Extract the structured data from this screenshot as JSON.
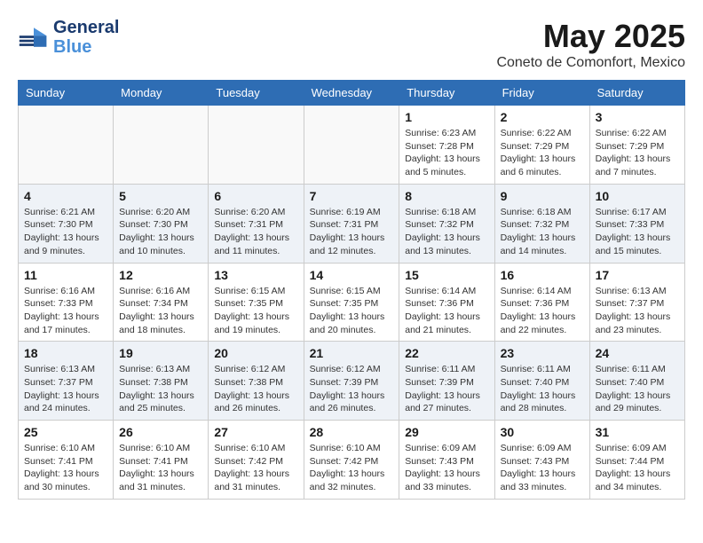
{
  "header": {
    "logo_line1": "General",
    "logo_line2": "Blue",
    "month": "May 2025",
    "location": "Coneto de Comonfort, Mexico"
  },
  "weekdays": [
    "Sunday",
    "Monday",
    "Tuesday",
    "Wednesday",
    "Thursday",
    "Friday",
    "Saturday"
  ],
  "weeks": [
    [
      {
        "day": "",
        "info": ""
      },
      {
        "day": "",
        "info": ""
      },
      {
        "day": "",
        "info": ""
      },
      {
        "day": "",
        "info": ""
      },
      {
        "day": "1",
        "info": "Sunrise: 6:23 AM\nSunset: 7:28 PM\nDaylight: 13 hours and 5 minutes."
      },
      {
        "day": "2",
        "info": "Sunrise: 6:22 AM\nSunset: 7:29 PM\nDaylight: 13 hours and 6 minutes."
      },
      {
        "day": "3",
        "info": "Sunrise: 6:22 AM\nSunset: 7:29 PM\nDaylight: 13 hours and 7 minutes."
      }
    ],
    [
      {
        "day": "4",
        "info": "Sunrise: 6:21 AM\nSunset: 7:30 PM\nDaylight: 13 hours and 9 minutes."
      },
      {
        "day": "5",
        "info": "Sunrise: 6:20 AM\nSunset: 7:30 PM\nDaylight: 13 hours and 10 minutes."
      },
      {
        "day": "6",
        "info": "Sunrise: 6:20 AM\nSunset: 7:31 PM\nDaylight: 13 hours and 11 minutes."
      },
      {
        "day": "7",
        "info": "Sunrise: 6:19 AM\nSunset: 7:31 PM\nDaylight: 13 hours and 12 minutes."
      },
      {
        "day": "8",
        "info": "Sunrise: 6:18 AM\nSunset: 7:32 PM\nDaylight: 13 hours and 13 minutes."
      },
      {
        "day": "9",
        "info": "Sunrise: 6:18 AM\nSunset: 7:32 PM\nDaylight: 13 hours and 14 minutes."
      },
      {
        "day": "10",
        "info": "Sunrise: 6:17 AM\nSunset: 7:33 PM\nDaylight: 13 hours and 15 minutes."
      }
    ],
    [
      {
        "day": "11",
        "info": "Sunrise: 6:16 AM\nSunset: 7:33 PM\nDaylight: 13 hours and 17 minutes."
      },
      {
        "day": "12",
        "info": "Sunrise: 6:16 AM\nSunset: 7:34 PM\nDaylight: 13 hours and 18 minutes."
      },
      {
        "day": "13",
        "info": "Sunrise: 6:15 AM\nSunset: 7:35 PM\nDaylight: 13 hours and 19 minutes."
      },
      {
        "day": "14",
        "info": "Sunrise: 6:15 AM\nSunset: 7:35 PM\nDaylight: 13 hours and 20 minutes."
      },
      {
        "day": "15",
        "info": "Sunrise: 6:14 AM\nSunset: 7:36 PM\nDaylight: 13 hours and 21 minutes."
      },
      {
        "day": "16",
        "info": "Sunrise: 6:14 AM\nSunset: 7:36 PM\nDaylight: 13 hours and 22 minutes."
      },
      {
        "day": "17",
        "info": "Sunrise: 6:13 AM\nSunset: 7:37 PM\nDaylight: 13 hours and 23 minutes."
      }
    ],
    [
      {
        "day": "18",
        "info": "Sunrise: 6:13 AM\nSunset: 7:37 PM\nDaylight: 13 hours and 24 minutes."
      },
      {
        "day": "19",
        "info": "Sunrise: 6:13 AM\nSunset: 7:38 PM\nDaylight: 13 hours and 25 minutes."
      },
      {
        "day": "20",
        "info": "Sunrise: 6:12 AM\nSunset: 7:38 PM\nDaylight: 13 hours and 26 minutes."
      },
      {
        "day": "21",
        "info": "Sunrise: 6:12 AM\nSunset: 7:39 PM\nDaylight: 13 hours and 26 minutes."
      },
      {
        "day": "22",
        "info": "Sunrise: 6:11 AM\nSunset: 7:39 PM\nDaylight: 13 hours and 27 minutes."
      },
      {
        "day": "23",
        "info": "Sunrise: 6:11 AM\nSunset: 7:40 PM\nDaylight: 13 hours and 28 minutes."
      },
      {
        "day": "24",
        "info": "Sunrise: 6:11 AM\nSunset: 7:40 PM\nDaylight: 13 hours and 29 minutes."
      }
    ],
    [
      {
        "day": "25",
        "info": "Sunrise: 6:10 AM\nSunset: 7:41 PM\nDaylight: 13 hours and 30 minutes."
      },
      {
        "day": "26",
        "info": "Sunrise: 6:10 AM\nSunset: 7:41 PM\nDaylight: 13 hours and 31 minutes."
      },
      {
        "day": "27",
        "info": "Sunrise: 6:10 AM\nSunset: 7:42 PM\nDaylight: 13 hours and 31 minutes."
      },
      {
        "day": "28",
        "info": "Sunrise: 6:10 AM\nSunset: 7:42 PM\nDaylight: 13 hours and 32 minutes."
      },
      {
        "day": "29",
        "info": "Sunrise: 6:09 AM\nSunset: 7:43 PM\nDaylight: 13 hours and 33 minutes."
      },
      {
        "day": "30",
        "info": "Sunrise: 6:09 AM\nSunset: 7:43 PM\nDaylight: 13 hours and 33 minutes."
      },
      {
        "day": "31",
        "info": "Sunrise: 6:09 AM\nSunset: 7:44 PM\nDaylight: 13 hours and 34 minutes."
      }
    ]
  ]
}
